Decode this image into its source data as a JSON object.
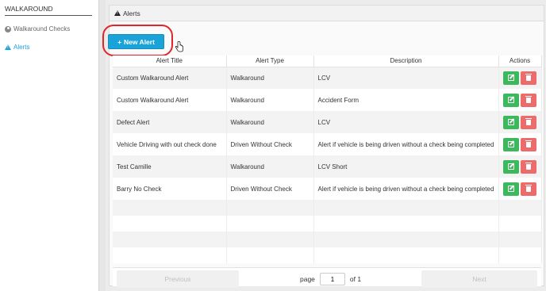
{
  "sidebar": {
    "title": "WALKAROUND",
    "items": [
      {
        "label": "Walkaround Checks"
      },
      {
        "label": "Alerts"
      }
    ]
  },
  "panel": {
    "title": "Alerts",
    "new_button_label": "New Alert"
  },
  "table": {
    "columns": [
      "Alert Title",
      "Alert Type",
      "Description",
      "Actions"
    ],
    "rows": [
      {
        "title": "Custom Walkaround Alert",
        "type": "Walkaround",
        "description": "LCV"
      },
      {
        "title": "Custom Walkaround Alert",
        "type": "Walkaround",
        "description": "Accident Form"
      },
      {
        "title": "Defect Alert",
        "type": "Walkaround",
        "description": "LCV"
      },
      {
        "title": "Vehicle Driving with out check done",
        "type": "Driven Without Check",
        "description": "Alert if vehicle is being driven without a check being completed"
      },
      {
        "title": "Test Camille",
        "type": "Walkaround",
        "description": "LCV Short"
      },
      {
        "title": "Barry No Check",
        "type": "Driven Without Check",
        "description": "Alert if vehicle is being driven without a check being completed"
      }
    ]
  },
  "pager": {
    "previous_label": "Previous",
    "next_label": "Next",
    "page_label": "page",
    "page_value": "1",
    "of_label": "of 1"
  },
  "colors": {
    "accent": "#1aa3d9",
    "edit": "#3db85c",
    "delete": "#ec6b6b",
    "highlight_ring": "#e0262b"
  },
  "icons": {
    "sidebar_checks": "user-circle-icon",
    "sidebar_alerts": "warning-icon",
    "panel_title": "warning-icon",
    "new_button": "plus-icon",
    "row_edit": "edit-icon",
    "row_delete": "trash-icon"
  }
}
